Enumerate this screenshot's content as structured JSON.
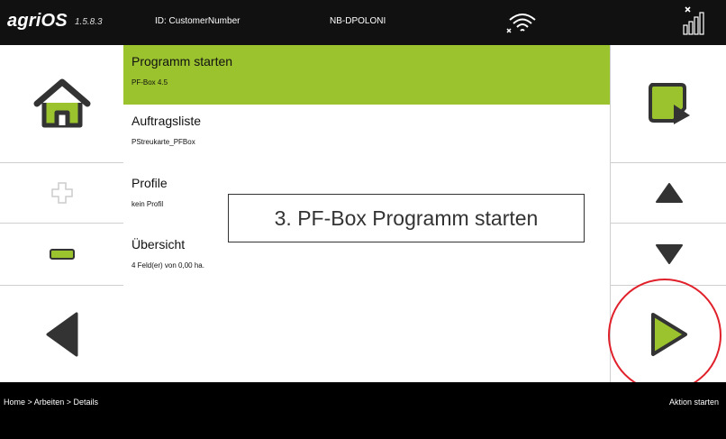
{
  "topbar": {
    "brand": "agriOS",
    "version": "1.5.8.3",
    "id_label": "ID: CustomerNumber",
    "device_name": "NB-DPOLONI"
  },
  "menu": {
    "items": [
      {
        "title": "Programm starten",
        "subtitle": "PF-Box 4.5",
        "active": true
      },
      {
        "title": "Auftragsliste",
        "subtitle": "PStreukarte_PFBox",
        "active": false
      },
      {
        "title": "Profile",
        "subtitle": "kein Profil",
        "active": false
      },
      {
        "title": "Übersicht",
        "subtitle": "4 Feld(er) von 0,00 ha.",
        "active": false
      }
    ]
  },
  "callout": "3. PF-Box Programm starten",
  "footer": {
    "breadcrumb": "Home > Arbeiten > Details",
    "action": "Aktion starten"
  },
  "colors": {
    "accent": "#9bc32e",
    "icon_dark": "#333333",
    "highlight_circle": "#e0202a",
    "bar": "#111111"
  },
  "icons": [
    "home-icon",
    "plus-icon",
    "minus-icon",
    "arrow-left-icon",
    "select-icon",
    "arrow-up-icon",
    "arrow-down-icon",
    "play-icon",
    "wifi-off-icon",
    "signal-off-icon"
  ]
}
